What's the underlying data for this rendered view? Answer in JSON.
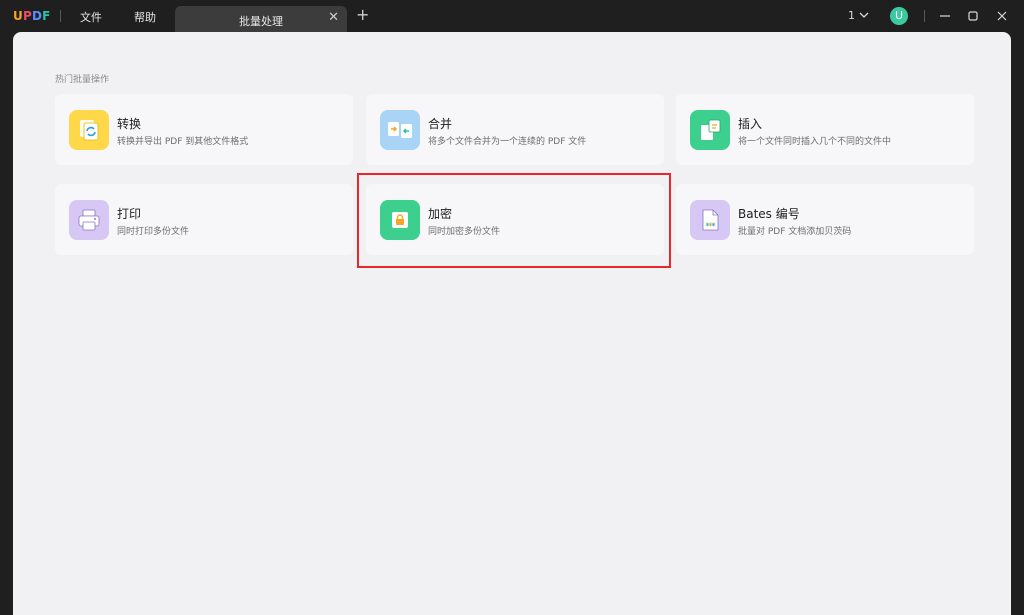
{
  "app": {
    "logo": [
      "U",
      "P",
      "D",
      "F"
    ],
    "logo_colors": [
      "#f5a623",
      "#e94b6a",
      "#5b8cff",
      "#2ec4a0"
    ]
  },
  "menu": {
    "file": "文件",
    "help": "帮助"
  },
  "tab": {
    "label": "批量处理",
    "close": "✕",
    "add": "+"
  },
  "window": {
    "page_count": "1",
    "avatar": "U"
  },
  "main": {
    "section_title": "热门批量操作",
    "cards": [
      {
        "title": "转换",
        "desc": "转换并导出 PDF 到其他文件格式",
        "icon": "convert-icon",
        "color": "#ffd84a"
      },
      {
        "title": "合并",
        "desc": "将多个文件合并为一个连续的 PDF 文件",
        "icon": "merge-icon",
        "color": "#a9d4f5"
      },
      {
        "title": "插入",
        "desc": "将一个文件同时插入几个不同的文件中",
        "icon": "insert-icon",
        "color": "#3ccf8e"
      },
      {
        "title": "打印",
        "desc": "同时打印多份文件",
        "icon": "print-icon",
        "color": "#d7c7f4"
      },
      {
        "title": "加密",
        "desc": "同时加密多份文件",
        "icon": "lock-icon",
        "color": "#3ccf8e"
      },
      {
        "title": "Bates 编号",
        "desc": "批量对 PDF 文档添加贝茨码",
        "icon": "bates-icon",
        "color": "#d7c7f4"
      }
    ]
  },
  "highlight_color": "#e8262b"
}
